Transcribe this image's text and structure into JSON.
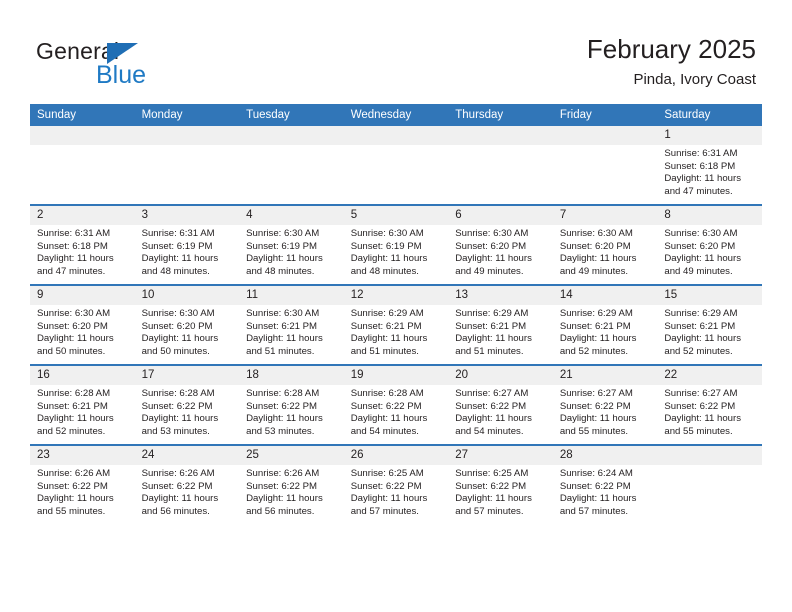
{
  "brand": {
    "name_part1": "General",
    "name_part2": "Blue",
    "triangle_color": "#1f6eb5",
    "blue_color": "#1f7ac4"
  },
  "header": {
    "title": "February 2025",
    "location": "Pinda, Ivory Coast",
    "header_bg": "#3176b8",
    "daynum_bg": "#f0f0f0"
  },
  "weekday_headers": [
    "Sunday",
    "Monday",
    "Tuesday",
    "Wednesday",
    "Thursday",
    "Friday",
    "Saturday"
  ],
  "labels": {
    "sunrise": "Sunrise:",
    "sunset": "Sunset:",
    "daylight": "Daylight:"
  },
  "weeks": [
    [
      {
        "day": "",
        "blank": true
      },
      {
        "day": "",
        "blank": true
      },
      {
        "day": "",
        "blank": true
      },
      {
        "day": "",
        "blank": true
      },
      {
        "day": "",
        "blank": true
      },
      {
        "day": "",
        "blank": true
      },
      {
        "day": "1",
        "sunrise": "Sunrise: 6:31 AM",
        "sunset": "Sunset: 6:18 PM",
        "daylight1": "Daylight: 11 hours",
        "daylight2": "and 47 minutes."
      }
    ],
    [
      {
        "day": "2",
        "sunrise": "Sunrise: 6:31 AM",
        "sunset": "Sunset: 6:18 PM",
        "daylight1": "Daylight: 11 hours",
        "daylight2": "and 47 minutes."
      },
      {
        "day": "3",
        "sunrise": "Sunrise: 6:31 AM",
        "sunset": "Sunset: 6:19 PM",
        "daylight1": "Daylight: 11 hours",
        "daylight2": "and 48 minutes."
      },
      {
        "day": "4",
        "sunrise": "Sunrise: 6:30 AM",
        "sunset": "Sunset: 6:19 PM",
        "daylight1": "Daylight: 11 hours",
        "daylight2": "and 48 minutes."
      },
      {
        "day": "5",
        "sunrise": "Sunrise: 6:30 AM",
        "sunset": "Sunset: 6:19 PM",
        "daylight1": "Daylight: 11 hours",
        "daylight2": "and 48 minutes."
      },
      {
        "day": "6",
        "sunrise": "Sunrise: 6:30 AM",
        "sunset": "Sunset: 6:20 PM",
        "daylight1": "Daylight: 11 hours",
        "daylight2": "and 49 minutes."
      },
      {
        "day": "7",
        "sunrise": "Sunrise: 6:30 AM",
        "sunset": "Sunset: 6:20 PM",
        "daylight1": "Daylight: 11 hours",
        "daylight2": "and 49 minutes."
      },
      {
        "day": "8",
        "sunrise": "Sunrise: 6:30 AM",
        "sunset": "Sunset: 6:20 PM",
        "daylight1": "Daylight: 11 hours",
        "daylight2": "and 49 minutes."
      }
    ],
    [
      {
        "day": "9",
        "sunrise": "Sunrise: 6:30 AM",
        "sunset": "Sunset: 6:20 PM",
        "daylight1": "Daylight: 11 hours",
        "daylight2": "and 50 minutes."
      },
      {
        "day": "10",
        "sunrise": "Sunrise: 6:30 AM",
        "sunset": "Sunset: 6:20 PM",
        "daylight1": "Daylight: 11 hours",
        "daylight2": "and 50 minutes."
      },
      {
        "day": "11",
        "sunrise": "Sunrise: 6:30 AM",
        "sunset": "Sunset: 6:21 PM",
        "daylight1": "Daylight: 11 hours",
        "daylight2": "and 51 minutes."
      },
      {
        "day": "12",
        "sunrise": "Sunrise: 6:29 AM",
        "sunset": "Sunset: 6:21 PM",
        "daylight1": "Daylight: 11 hours",
        "daylight2": "and 51 minutes."
      },
      {
        "day": "13",
        "sunrise": "Sunrise: 6:29 AM",
        "sunset": "Sunset: 6:21 PM",
        "daylight1": "Daylight: 11 hours",
        "daylight2": "and 51 minutes."
      },
      {
        "day": "14",
        "sunrise": "Sunrise: 6:29 AM",
        "sunset": "Sunset: 6:21 PM",
        "daylight1": "Daylight: 11 hours",
        "daylight2": "and 52 minutes."
      },
      {
        "day": "15",
        "sunrise": "Sunrise: 6:29 AM",
        "sunset": "Sunset: 6:21 PM",
        "daylight1": "Daylight: 11 hours",
        "daylight2": "and 52 minutes."
      }
    ],
    [
      {
        "day": "16",
        "sunrise": "Sunrise: 6:28 AM",
        "sunset": "Sunset: 6:21 PM",
        "daylight1": "Daylight: 11 hours",
        "daylight2": "and 52 minutes."
      },
      {
        "day": "17",
        "sunrise": "Sunrise: 6:28 AM",
        "sunset": "Sunset: 6:22 PM",
        "daylight1": "Daylight: 11 hours",
        "daylight2": "and 53 minutes."
      },
      {
        "day": "18",
        "sunrise": "Sunrise: 6:28 AM",
        "sunset": "Sunset: 6:22 PM",
        "daylight1": "Daylight: 11 hours",
        "daylight2": "and 53 minutes."
      },
      {
        "day": "19",
        "sunrise": "Sunrise: 6:28 AM",
        "sunset": "Sunset: 6:22 PM",
        "daylight1": "Daylight: 11 hours",
        "daylight2": "and 54 minutes."
      },
      {
        "day": "20",
        "sunrise": "Sunrise: 6:27 AM",
        "sunset": "Sunset: 6:22 PM",
        "daylight1": "Daylight: 11 hours",
        "daylight2": "and 54 minutes."
      },
      {
        "day": "21",
        "sunrise": "Sunrise: 6:27 AM",
        "sunset": "Sunset: 6:22 PM",
        "daylight1": "Daylight: 11 hours",
        "daylight2": "and 55 minutes."
      },
      {
        "day": "22",
        "sunrise": "Sunrise: 6:27 AM",
        "sunset": "Sunset: 6:22 PM",
        "daylight1": "Daylight: 11 hours",
        "daylight2": "and 55 minutes."
      }
    ],
    [
      {
        "day": "23",
        "sunrise": "Sunrise: 6:26 AM",
        "sunset": "Sunset: 6:22 PM",
        "daylight1": "Daylight: 11 hours",
        "daylight2": "and 55 minutes."
      },
      {
        "day": "24",
        "sunrise": "Sunrise: 6:26 AM",
        "sunset": "Sunset: 6:22 PM",
        "daylight1": "Daylight: 11 hours",
        "daylight2": "and 56 minutes."
      },
      {
        "day": "25",
        "sunrise": "Sunrise: 6:26 AM",
        "sunset": "Sunset: 6:22 PM",
        "daylight1": "Daylight: 11 hours",
        "daylight2": "and 56 minutes."
      },
      {
        "day": "26",
        "sunrise": "Sunrise: 6:25 AM",
        "sunset": "Sunset: 6:22 PM",
        "daylight1": "Daylight: 11 hours",
        "daylight2": "and 57 minutes."
      },
      {
        "day": "27",
        "sunrise": "Sunrise: 6:25 AM",
        "sunset": "Sunset: 6:22 PM",
        "daylight1": "Daylight: 11 hours",
        "daylight2": "and 57 minutes."
      },
      {
        "day": "28",
        "sunrise": "Sunrise: 6:24 AM",
        "sunset": "Sunset: 6:22 PM",
        "daylight1": "Daylight: 11 hours",
        "daylight2": "and 57 minutes."
      },
      {
        "day": "",
        "blank": true
      }
    ]
  ]
}
